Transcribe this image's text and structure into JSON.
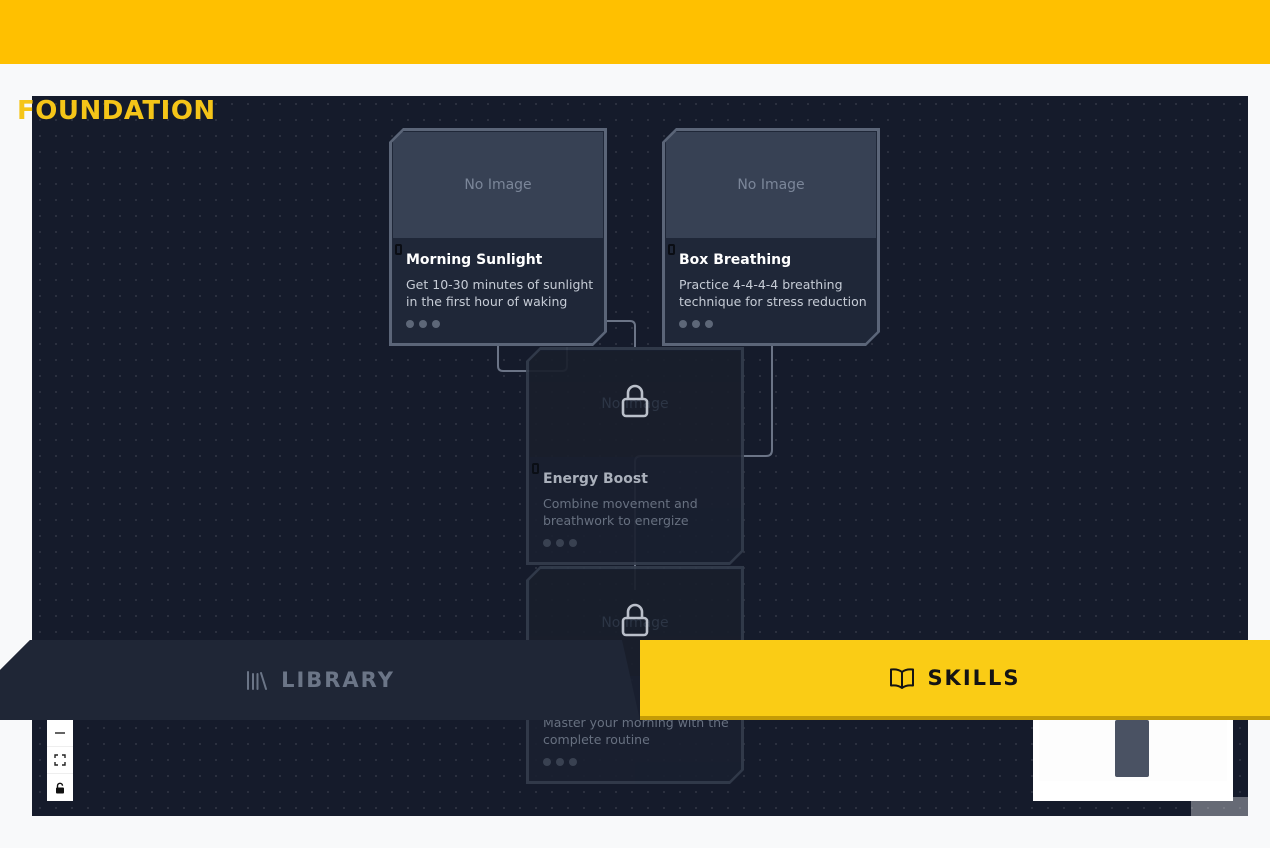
{
  "section": {
    "title": "FOUNDATION"
  },
  "nodes": [
    {
      "title": "Morning Sunlight",
      "description": "Get 10-30 minutes of sunlight in the first hour of waking",
      "image_placeholder": "No Image",
      "locked": false
    },
    {
      "title": "Box Breathing",
      "description": "Practice 4-4-4-4 breathing technique for stress reduction",
      "image_placeholder": "No Image",
      "locked": false
    },
    {
      "title": "Energy Boost",
      "description": "Combine movement and breathwork to energize your…",
      "image_placeholder": "No Image",
      "locked": true,
      "icon": "lock-icon"
    },
    {
      "title": "",
      "description": "Master your morning with the complete routine",
      "image_placeholder": "No Image",
      "locked": true,
      "icon": "lock-icon"
    }
  ],
  "controls": {
    "zoom_out_icon": "minus-icon",
    "fit_icon": "fit-view-icon",
    "lock_icon": "lock-icon"
  },
  "tabs": [
    {
      "label": "LIBRARY",
      "icon": "library-icon",
      "active": false
    },
    {
      "label": "SKILLS",
      "icon": "book-open-icon",
      "active": true
    }
  ],
  "colors": {
    "accent": "#facc15",
    "header": "#ffc000",
    "canvas": "#151b2b"
  }
}
